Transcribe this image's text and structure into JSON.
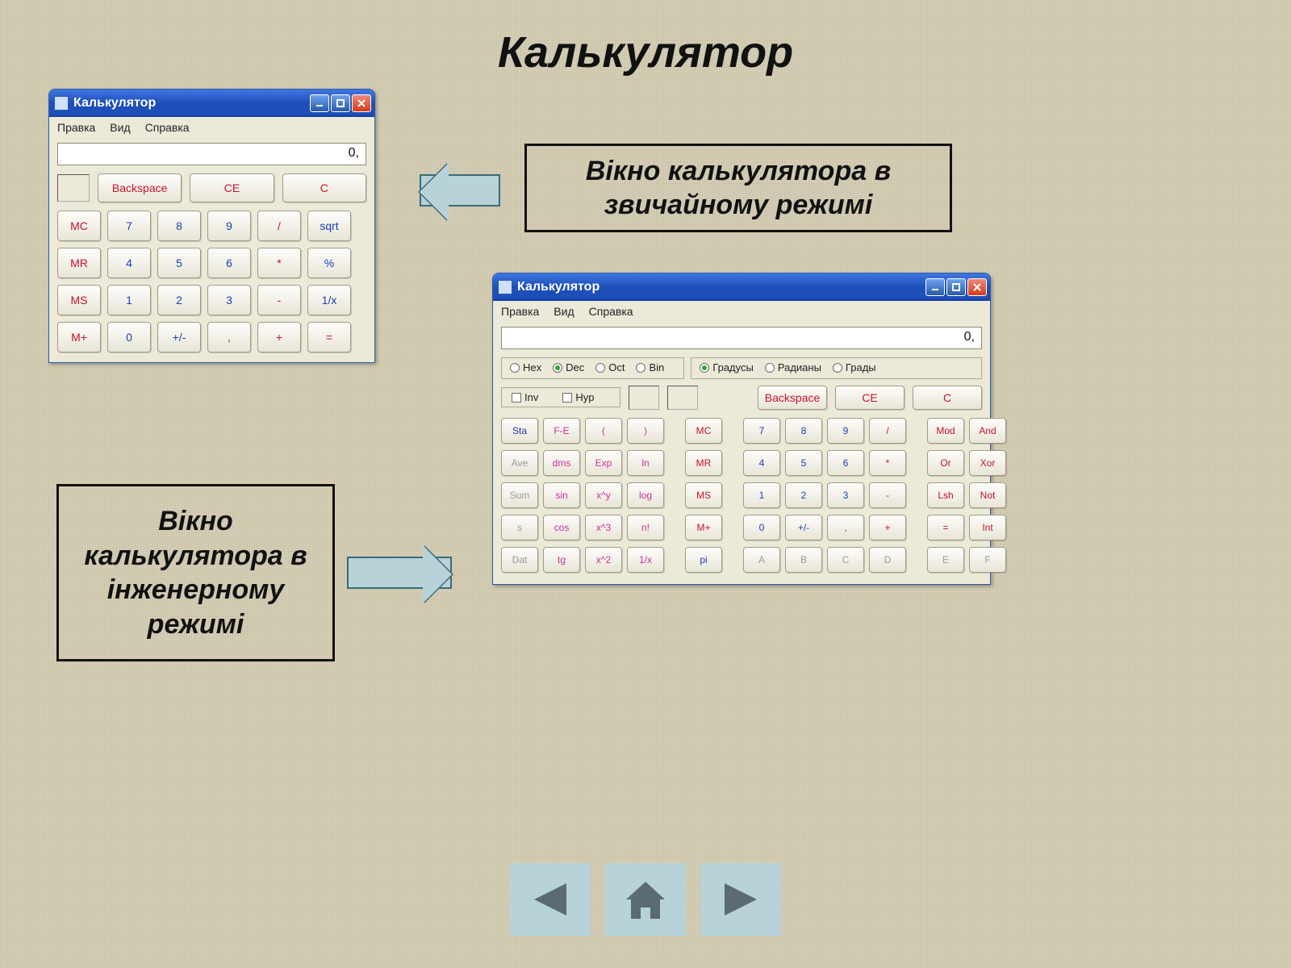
{
  "page_title": "Калькулятор",
  "caption_standard": "Вікно калькулятора в звичайному режимі",
  "caption_scientific": "Вікно\nкалькулятора в\nінженерному\nрежимі",
  "standard_calc": {
    "window_title": "Калькулятор",
    "menu": [
      "Правка",
      "Вид",
      "Справка"
    ],
    "display_value": "0,",
    "top_buttons": [
      "Backspace",
      "CE",
      "C"
    ],
    "rows": [
      [
        "MC",
        "7",
        "8",
        "9",
        "/",
        "sqrt"
      ],
      [
        "MR",
        "4",
        "5",
        "6",
        "*",
        "%"
      ],
      [
        "MS",
        "1",
        "2",
        "3",
        "-",
        "1/x"
      ],
      [
        "M+",
        "0",
        "+/-",
        ",",
        "+",
        "="
      ]
    ],
    "colors": {
      "MC": "red",
      "MR": "red",
      "MS": "red",
      "M+": "red",
      "7": "blue",
      "8": "blue",
      "9": "blue",
      "4": "blue",
      "5": "blue",
      "6": "blue",
      "1": "blue",
      "2": "blue",
      "3": "blue",
      "0": "blue",
      "+/-": "blue",
      ",": "blue",
      "/": "red",
      "*": "red",
      "-": "red",
      "+": "red",
      "=": "red",
      "sqrt": "blue",
      "%": "blue",
      "1/x": "blue",
      "Backspace": "red",
      "CE": "red",
      "C": "red"
    }
  },
  "scientific_calc": {
    "window_title": "Калькулятор",
    "menu": [
      "Правка",
      "Вид",
      "Справка"
    ],
    "display_value": "0,",
    "number_system": {
      "options": [
        "Hex",
        "Dec",
        "Oct",
        "Bin"
      ],
      "selected": "Dec"
    },
    "angle_unit": {
      "options": [
        "Градусы",
        "Радианы",
        "Грады"
      ],
      "selected": "Градусы"
    },
    "checks": [
      "Inv",
      "Hyp"
    ],
    "clear_buttons": [
      "Backspace",
      "CE",
      "C"
    ],
    "grid_rows": [
      [
        "Sta",
        "F-E",
        "(",
        ")",
        "MC",
        "7",
        "8",
        "9",
        "/",
        "Mod",
        "And"
      ],
      [
        "Ave",
        "dms",
        "Exp",
        "ln",
        "MR",
        "4",
        "5",
        "6",
        "*",
        "Or",
        "Xor"
      ],
      [
        "Sum",
        "sin",
        "x^y",
        "log",
        "MS",
        "1",
        "2",
        "3",
        "-",
        "Lsh",
        "Not"
      ],
      [
        "s",
        "cos",
        "x^3",
        "n!",
        "M+",
        "0",
        "+/-",
        ",",
        "+",
        "=",
        "Int"
      ],
      [
        "Dat",
        "tg",
        "x^2",
        "1/x",
        "pi",
        "A",
        "B",
        "C",
        "D",
        "E",
        "F"
      ]
    ],
    "colors": {
      "Sta": "blue",
      "Ave": "gray",
      "Sum": "gray",
      "s": "gray",
      "Dat": "gray",
      "F-E": "pink",
      "dms": "pink",
      "Exp": "pink",
      "ln": "pink",
      "sin": "pink",
      "x^y": "pink",
      "log": "pink",
      "cos": "pink",
      "x^3": "pink",
      "n!": "pink",
      "tg": "pink",
      "x^2": "pink",
      "1/x": "pink",
      "(": "pink",
      ")": "pink",
      "MC": "red",
      "MR": "red",
      "MS": "red",
      "M+": "red",
      "pi": "blue",
      "7": "blue",
      "8": "blue",
      "9": "blue",
      "4": "blue",
      "5": "blue",
      "6": "blue",
      "1": "blue",
      "2": "blue",
      "3": "blue",
      "0": "blue",
      "+/-": "blue",
      ",": "blue",
      "/": "red",
      "*": "red",
      "-": "red",
      "+": "red",
      "=": "red",
      "Mod": "red",
      "And": "red",
      "Or": "red",
      "Xor": "red",
      "Lsh": "red",
      "Not": "red",
      "Int": "red",
      "A": "gray",
      "B": "gray",
      "C": "gray",
      "D": "gray",
      "E": "gray",
      "F": "gray",
      "Backspace": "red",
      "CE": "red",
      "C_clear": "red"
    }
  }
}
